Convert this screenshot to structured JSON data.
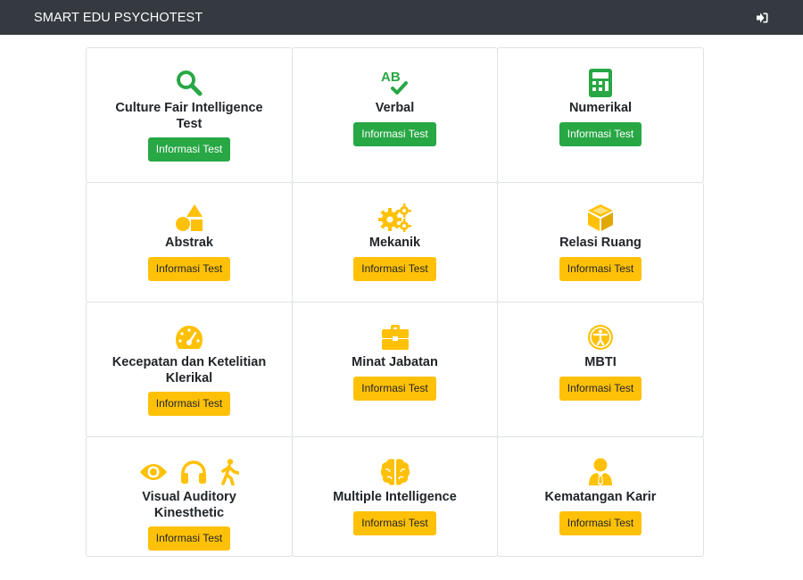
{
  "navbar": {
    "brand": "SMART EDU PSYCHOTEST",
    "logout_icon": "sign-out-icon"
  },
  "colors": {
    "navbar": "#343a40",
    "green": "#28a745",
    "yellow": "#ffc107"
  },
  "cards": [
    {
      "title": "Culture Fair Intelligence Test",
      "button": "Informasi Test",
      "icons": [
        "search-icon"
      ],
      "color": "green"
    },
    {
      "title": "Verbal",
      "button": "Informasi Test",
      "icons": [
        "spell-check-icon"
      ],
      "color": "green"
    },
    {
      "title": "Numerikal",
      "button": "Informasi Test",
      "icons": [
        "calculator-icon"
      ],
      "color": "green"
    },
    {
      "title": "Abstrak",
      "button": "Informasi Test",
      "icons": [
        "shapes-icon"
      ],
      "color": "yellow"
    },
    {
      "title": "Mekanik",
      "button": "Informasi Test",
      "icons": [
        "cogs-icon"
      ],
      "color": "yellow"
    },
    {
      "title": "Relasi Ruang",
      "button": "Informasi Test",
      "icons": [
        "cube-icon"
      ],
      "color": "yellow"
    },
    {
      "title": "Kecepatan dan Ketelitian Klerikal",
      "button": "Informasi Test",
      "icons": [
        "tachometer-icon"
      ],
      "color": "yellow"
    },
    {
      "title": "Minat Jabatan",
      "button": "Informasi Test",
      "icons": [
        "briefcase-icon"
      ],
      "color": "yellow"
    },
    {
      "title": "MBTI",
      "button": "Informasi Test",
      "icons": [
        "universal-access-icon"
      ],
      "color": "yellow"
    },
    {
      "title": "Visual Auditory Kinesthetic",
      "button": "Informasi Test",
      "icons": [
        "eye-icon",
        "headphones-icon",
        "walking-icon"
      ],
      "color": "yellow"
    },
    {
      "title": "Multiple Intelligence",
      "button": "Informasi Test",
      "icons": [
        "brain-icon"
      ],
      "color": "yellow"
    },
    {
      "title": "Kematangan Karir",
      "button": "Informasi Test",
      "icons": [
        "user-tie-icon"
      ],
      "color": "yellow"
    }
  ]
}
